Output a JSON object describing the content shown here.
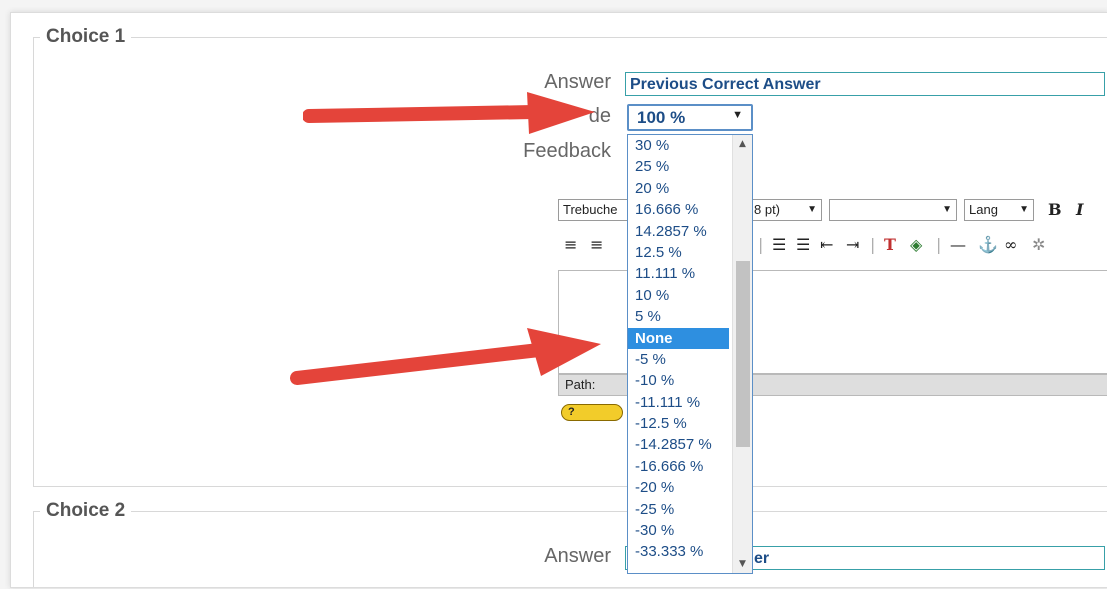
{
  "choice1": {
    "legend": "Choice 1",
    "answer_label": "Answer",
    "answer_value": "Previous Correct Answer",
    "grade_label": "Grade",
    "grade_visible_fragment": "de",
    "grade_value": "100 %",
    "feedback_label": "Feedback"
  },
  "editor": {
    "font_select": "Trebuche",
    "size_select": "8 pt)",
    "lang_select": "Lang",
    "bold": "B",
    "italic": "I",
    "path_label": "Path:",
    "help_badge": "?"
  },
  "dropdown": {
    "options": [
      "30 %",
      "25 %",
      "20 %",
      "16.666 %",
      "14.2857 %",
      "12.5 %",
      "11.111 %",
      "10 %",
      "5 %",
      "None",
      "-5 %",
      "-10 %",
      "-11.111 %",
      "-12.5 %",
      "-14.2857 %",
      "-16.666 %",
      "-20 %",
      "-25 %",
      "-30 %",
      "-33.333 %"
    ],
    "selected_index": 9
  },
  "choice2": {
    "legend": "Choice 2",
    "answer_label": "Answer",
    "answer_fragment": "er"
  },
  "colors": {
    "arrow": "#e4443a",
    "highlight": "#2e8fe0",
    "text_blue": "#1d4d87"
  }
}
